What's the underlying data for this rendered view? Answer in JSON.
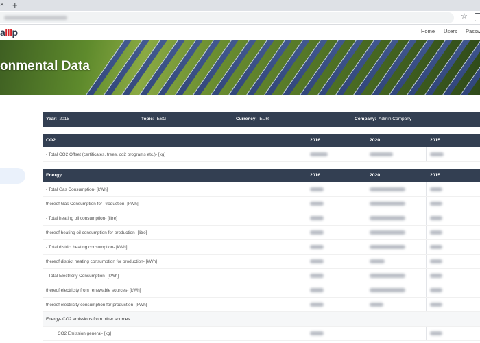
{
  "browser": {
    "tab_close_glyph": "×",
    "new_tab_glyph": "+",
    "bookmark_icon": "star-icon",
    "extensions_icon": "extensions-icon"
  },
  "nav": {
    "logo_text": "a",
    "logo_bars": "lll",
    "logo_tail": "p",
    "links": [
      "Home",
      "Users",
      "Passw"
    ]
  },
  "hero": {
    "title": "onmental Data"
  },
  "filters": {
    "year_label": "Year:",
    "year_value": "2015",
    "topic_label": "Topic:",
    "topic_value": "ESG",
    "currency_label": "Currency:",
    "currency_value": "EUR",
    "company_label": "Company:",
    "company_value": "Admin Company"
  },
  "co2_table": {
    "title": "CO2",
    "columns": [
      "2016",
      "2020",
      "2015"
    ],
    "rows": [
      "- Total CO2 Offset (certificates, trees, co2 programs etc.)- [kg]"
    ]
  },
  "energy_table": {
    "title": "Energy",
    "columns": [
      "2016",
      "2020",
      "2015"
    ],
    "rows": [
      "- Total Gas Consumption- [kWh]",
      "thereof Gas Consumption for Production- [kWh]",
      "- Total heating oil consumption- [litre]",
      "thereof heating oil consumption for production- [litre]",
      "- Total district heating consumption- [kWh]",
      "thereof district heating consumption for production- [kWh]",
      "- Total Electricity Consumption- [kWh]",
      "thereof electricity from renewable sources- [kWh]",
      "thereof electricity consumption for production- [kWh]",
      "Energy- CO2 emissions from other sources",
      "CO2 Emission general- [kg]"
    ]
  },
  "colors": {
    "header_bg": "#333f52",
    "logo_red": "#d8232a",
    "side_pill": "#eaf1fb"
  }
}
